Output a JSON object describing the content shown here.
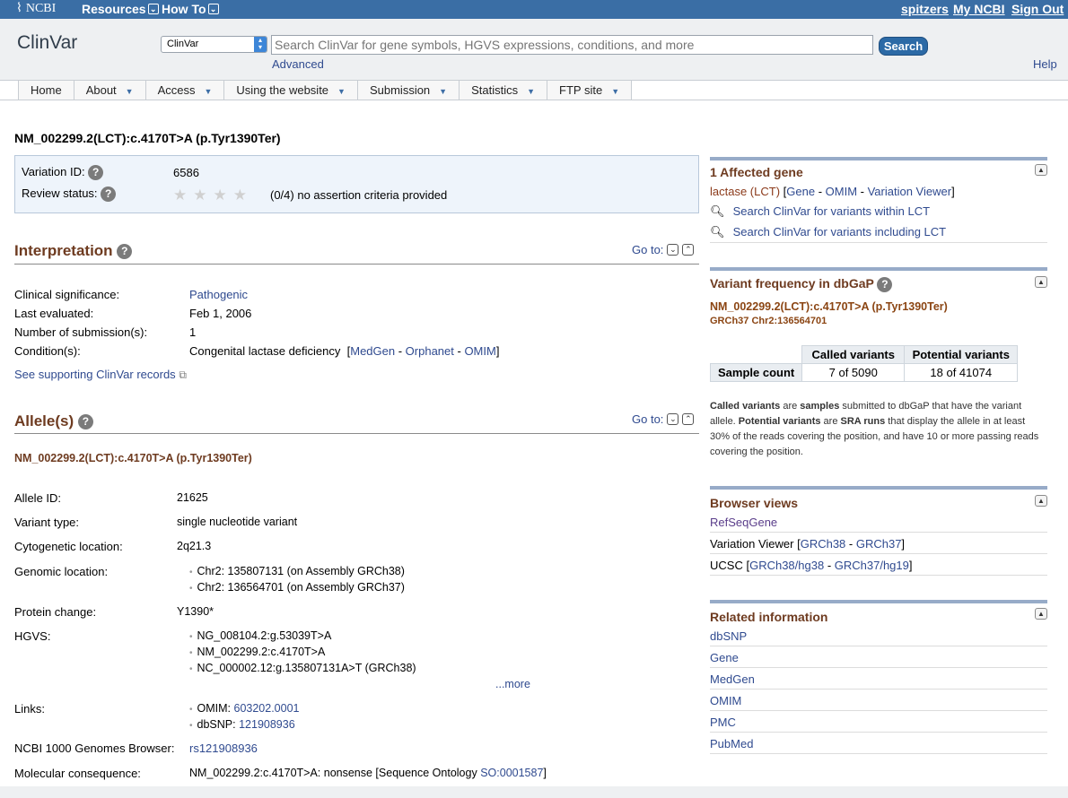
{
  "topbar": {
    "logo": "NCBI",
    "menus": [
      "Resources",
      "How To"
    ],
    "user_links": [
      "spitzers",
      "My NCBI",
      "Sign Out"
    ]
  },
  "header": {
    "app_title": "ClinVar",
    "db_select": "ClinVar",
    "search_placeholder": "Search ClinVar for gene symbols, HGVS expressions, conditions, and more",
    "search_button": "Search",
    "advanced": "Advanced",
    "help": "Help"
  },
  "nav": [
    {
      "label": "Home",
      "has_menu": false
    },
    {
      "label": "About",
      "has_menu": true
    },
    {
      "label": "Access",
      "has_menu": true
    },
    {
      "label": "Using the website",
      "has_menu": true
    },
    {
      "label": "Submission",
      "has_menu": true
    },
    {
      "label": "Statistics",
      "has_menu": true
    },
    {
      "label": "FTP site",
      "has_menu": true
    }
  ],
  "variant": {
    "title": "NM_002299.2(LCT):c.4170T>A (p.Tyr1390Ter)",
    "variation_id_label": "Variation ID:",
    "variation_id": "6586",
    "review_status_label": "Review status:",
    "review_stars": "(0/4) no assertion criteria provided",
    "review_score": 0
  },
  "interpretation": {
    "heading": "Interpretation",
    "goto": "Go to:",
    "clinical_significance_label": "Clinical significance:",
    "clinical_significance": "Pathogenic",
    "last_evaluated_label": "Last evaluated:",
    "last_evaluated": "Feb 1, 2006",
    "num_submissions_label": "Number of submission(s):",
    "num_submissions": "1",
    "conditions_label": "Condition(s):",
    "condition": "Congenital lactase deficiency",
    "condition_links": [
      "MedGen",
      "Orphanet",
      "OMIM"
    ],
    "supporting_link": "See supporting ClinVar records"
  },
  "allele": {
    "heading": "Allele(s)",
    "goto": "Go to:",
    "subtitle": "NM_002299.2(LCT):c.4170T>A (p.Tyr1390Ter)",
    "allele_id_label": "Allele ID:",
    "allele_id": "21625",
    "variant_type_label": "Variant type:",
    "variant_type": "single nucleotide variant",
    "cytogenetic_label": "Cytogenetic location:",
    "cytogenetic": "2q21.3",
    "genomic_label": "Genomic location:",
    "genomic": [
      "Chr2: 135807131 (on Assembly GRCh38)",
      "Chr2: 136564701 (on Assembly GRCh37)"
    ],
    "protein_label": "Protein change:",
    "protein": "Y1390*",
    "hgvs_label": "HGVS:",
    "hgvs": [
      "NG_008104.2:g.53039T>A",
      "NM_002299.2:c.4170T>A",
      "NC_000002.12:g.135807131A>T (GRCh38)"
    ],
    "more": "...more",
    "links_label": "Links:",
    "links": [
      {
        "prefix": "OMIM:",
        "link": "603202.0001"
      },
      {
        "prefix": "dbSNP:",
        "link": "121908936"
      }
    ],
    "genomes_label": "NCBI 1000 Genomes Browser:",
    "genomes": "rs121908936",
    "molcons_label": "Molecular consequence:",
    "molcons_text": "NM_002299.2:c.4170T>A: nonsense [Sequence Ontology",
    "molcons_link": "SO:0001587",
    "molcons_close": "]"
  },
  "sidebar": {
    "affected_gene": {
      "title": "1 Affected gene",
      "gene": "lactase (LCT)",
      "gene_links": [
        "Gene",
        "OMIM",
        "Variation Viewer"
      ],
      "search_within": "Search ClinVar for variants within LCT",
      "search_including": "Search ClinVar for variants including LCT"
    },
    "dbgap": {
      "title": "Variant frequency in dbGaP",
      "variant": "NM_002299.2(LCT):c.4170T>A (p.Tyr1390Ter)",
      "position": "GRCh37 Chr2:136564701",
      "col_called": "Called variants",
      "col_potential": "Potential variants",
      "row_label": "Sample count",
      "called": "7 of 5090",
      "potential": "18 of 41074",
      "note_1b": "Called variants",
      "note_2": " are ",
      "note_3b": "samples",
      "note_4": " submitted to dbGaP that have the variant allele. ",
      "note_5b": "Potential variants",
      "note_6": " are ",
      "note_7b": "SRA runs",
      "note_8": " that display the allele in at least 30% of the reads covering the position, and have 10 or more passing reads covering the position."
    },
    "browser": {
      "title": "Browser views",
      "refseqgene": "RefSeqGene",
      "vv_label": "Variation Viewer",
      "vv_links": [
        "GRCh38",
        "GRCh37"
      ],
      "ucsc_label": "UCSC",
      "ucsc_links": [
        "GRCh38/hg38",
        "GRCh37/hg19"
      ]
    },
    "related": {
      "title": "Related information",
      "items": [
        "dbSNP",
        "Gene",
        "MedGen",
        "OMIM",
        "PMC",
        "PubMed"
      ]
    }
  }
}
